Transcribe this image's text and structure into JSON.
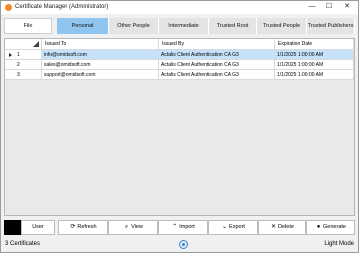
{
  "window": {
    "title": "Certificate Manager (Administrator)",
    "minimize_glyph": "—",
    "maximize_glyph": "☐",
    "close_glyph": "✕"
  },
  "tabs": {
    "file": "File",
    "items": [
      "Personal",
      "Other People",
      "Intermediate",
      "Trusted Root",
      "Trusted People",
      "Trusted Publishers"
    ],
    "active": "Personal"
  },
  "grid": {
    "columns": [
      "Issued To",
      "Issued By",
      "Expiration Date"
    ],
    "rows": [
      {
        "num": "1",
        "issued_to": "info@omidsoft.com",
        "issued_by": "Actalis Client Authentication CA G3",
        "expires": "1/1/2025 1:00:00 AM"
      },
      {
        "num": "2",
        "issued_to": "sales@omidsoft.com",
        "issued_by": "Actalis Client Authentication CA G3",
        "expires": "1/1/2025 1:00:00 AM"
      },
      {
        "num": "3",
        "issued_to": "support@omidsoft.com",
        "issued_by": "Actalis Client Authentication CA G3",
        "expires": "1/1/2025 1:00:00 AM"
      }
    ],
    "selected_row": "1"
  },
  "toolbar": {
    "store_label": "User",
    "refresh": "Refresh",
    "view": "View",
    "import": "Import",
    "export": "Export",
    "delete": "Delete",
    "generate": "Generate"
  },
  "status": {
    "count": "3 Certificates",
    "theme": "Light Mode"
  },
  "colors": {
    "active_tab": "#8fc5ee",
    "selected_row": "#c6e2fa",
    "app_icon": "#f08a24"
  }
}
